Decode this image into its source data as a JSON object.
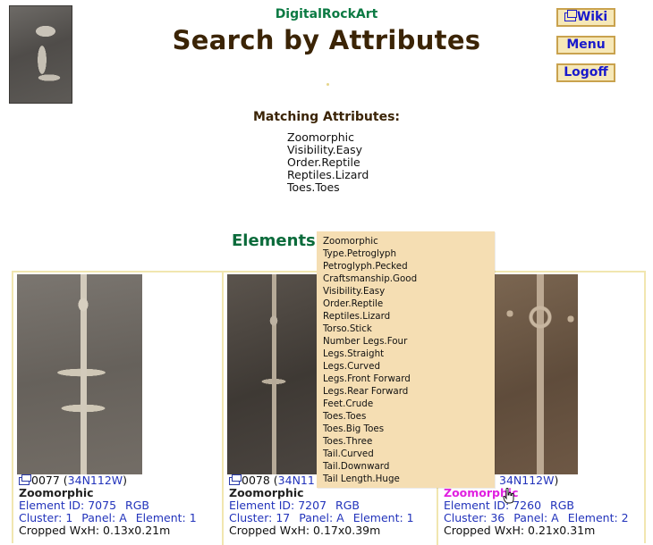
{
  "header": {
    "site_name": "DigitalRockArt",
    "title": "Search by Attributes"
  },
  "nav": {
    "wiki_label": "Wiki",
    "menu_label": "Menu",
    "logoff_label": "Logoff"
  },
  "matching": {
    "title": "Matching Attributes:",
    "attributes": [
      "Zoomorphic",
      "Visibility.Easy",
      "Order.Reptile",
      "Reptiles.Lizard",
      "Toes.Toes"
    ]
  },
  "elements_title": "Elements",
  "popup": {
    "items": [
      "Zoomorphic",
      "Type.Petroglyph",
      "Petroglyph.Pecked",
      "Craftsmanship.Good",
      "Visibility.Easy",
      "Order.Reptile",
      "Reptiles.Lizard",
      "Torso.Stick",
      "Number Legs.Four",
      "Legs.Straight",
      "Legs.Curved",
      "Legs.Front Forward",
      "Legs.Rear Forward",
      "Feet.Crude",
      "Toes.Toes",
      "Toes.Big Toes",
      "Toes.Three",
      "Tail.Curved",
      "Tail.Downward",
      "Tail Length.Huge"
    ]
  },
  "cards": [
    {
      "number": "0077",
      "location": "34N112W",
      "category": "Zoomorphic",
      "element_id_label": "Element ID: 7075",
      "rgb_label": "RGB",
      "cluster": "Cluster: 1",
      "panel": "Panel: A",
      "element": "Element: 1",
      "cropped": "Cropped WxH: 0.13x0.21m"
    },
    {
      "number": "0078",
      "location": "34N11",
      "category": "Zoomorphic",
      "element_id_label": "Element ID: 7207",
      "rgb_label": "RGB",
      "cluster": "Cluster: 17",
      "panel": "Panel: A",
      "element": "Element: 1",
      "cropped": "Cropped WxH: 0.17x0.39m"
    },
    {
      "number": "",
      "location": "34N112W",
      "category": "Zoomorphic",
      "element_id_label": "Element ID: 7260",
      "rgb_label": "RGB",
      "cluster": "Cluster: 36",
      "panel": "Panel: A",
      "element": "Element: 2",
      "cropped": "Cropped WxH: 0.21x0.31m"
    }
  ],
  "colors": {
    "title_brown": "#3b2406",
    "site_green": "#0b7a43",
    "link_blue": "#2233bb",
    "hover_magenta": "#e020e0",
    "popup_bg": "#f5deb3",
    "button_bg": "#f6e8b8"
  }
}
